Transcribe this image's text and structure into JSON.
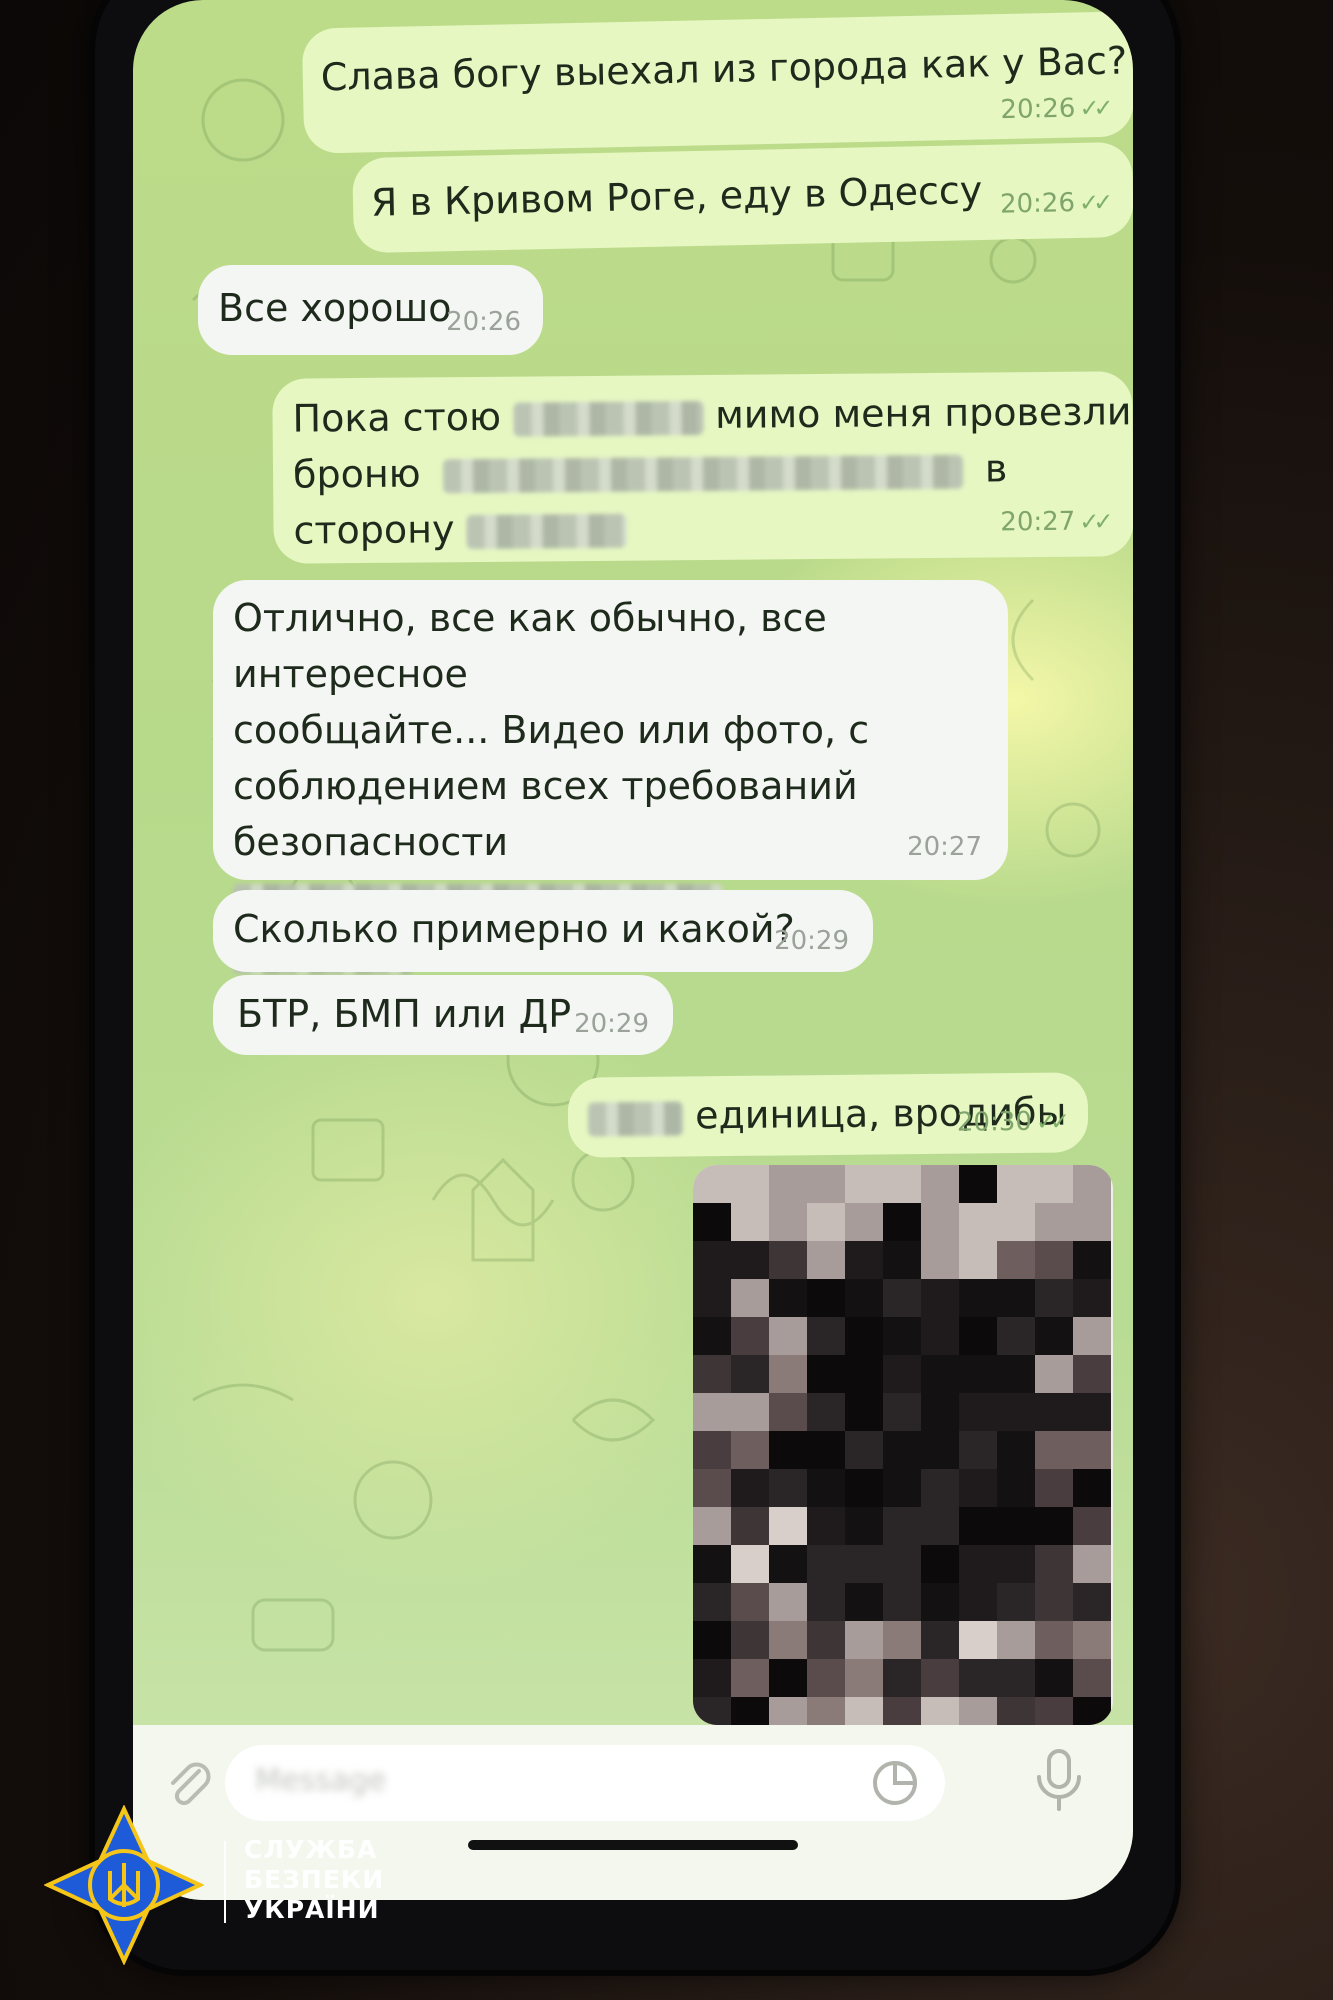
{
  "messages": [
    {
      "dir": "out",
      "text": "Слава богу выехал из города как у Вас?",
      "time": "20:26"
    },
    {
      "dir": "out",
      "text": "Я в Кривом Роге, еду в Одессу",
      "time": "20:26"
    },
    {
      "dir": "in",
      "text": "Все хорошо",
      "time": "20:26"
    },
    {
      "dir": "out",
      "line1a": "Пока стою",
      "line1b": "мимо меня провезли",
      "line2a": "броню",
      "line2b": "в",
      "line3a": "сторону",
      "time": "20:27"
    },
    {
      "dir": "in",
      "line1": "Отлично, все как обычно, все интересное",
      "line2": "сообщайте... Видео или фото, с",
      "line3": "соблюдением всех требований",
      "line4": "безопасности",
      "line5": "...",
      "time": "20:27"
    },
    {
      "dir": "in",
      "text": "Сколько примерно и какой?",
      "time": "20:29"
    },
    {
      "dir": "in",
      "text": "БТР, БМП или ДР",
      "time": "20:29"
    },
    {
      "dir": "out",
      "text": "единица, вродибы",
      "time": "20:30"
    }
  ],
  "checkmark": "✓✓",
  "input": {
    "placeholder": "Message"
  },
  "logo": {
    "line1": "СЛУЖБА",
    "line2": "БЕЗПЕКИ",
    "line3": "УКРАЇНИ"
  },
  "colors": {
    "bubble_out": "#e6f7c2",
    "bubble_in": "#f4f6f3",
    "logo_blue": "#1e5bd8",
    "logo_yellow": "#f5c518"
  }
}
